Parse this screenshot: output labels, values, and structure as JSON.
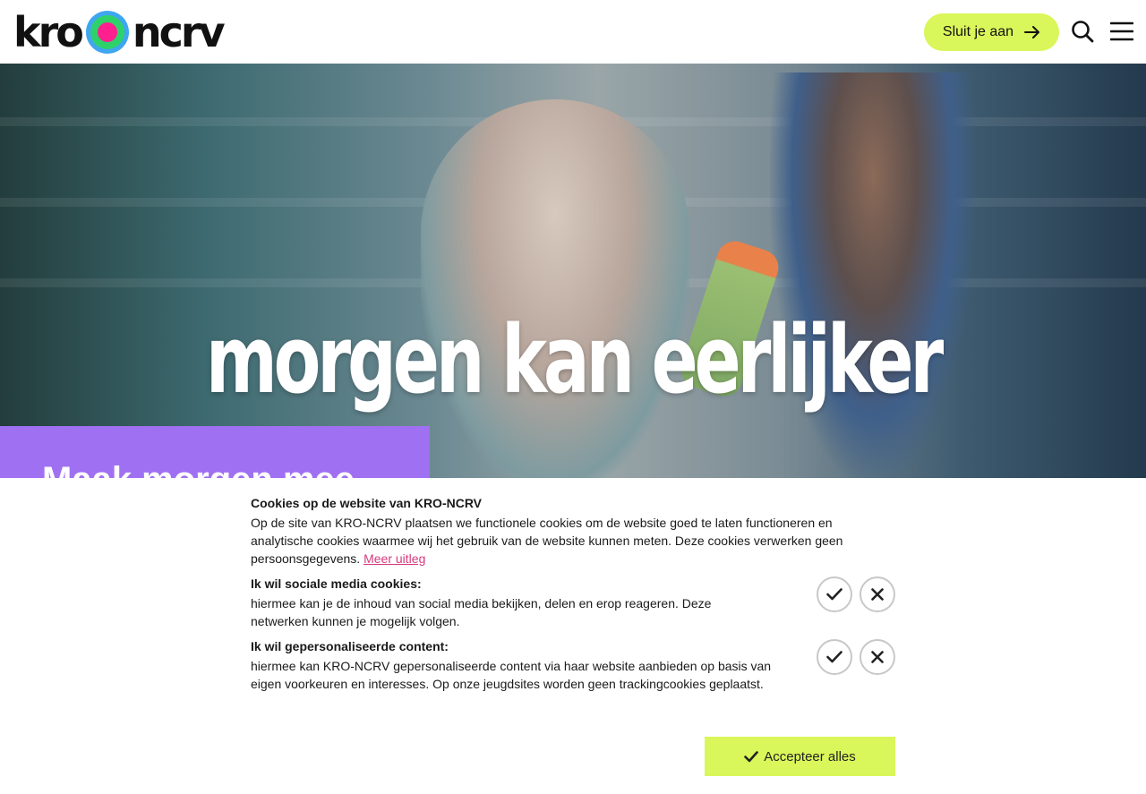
{
  "header": {
    "logo": {
      "left_text": "kro",
      "right_text": "ncrv",
      "icon": "kro-ncrv-circle-logo"
    },
    "join_label": "Sluit je aan",
    "join_icon": "arrow-right-icon",
    "search_icon": "search-icon",
    "menu_icon": "hamburger-menu-icon"
  },
  "hero": {
    "overlay_text": "morgen kan eerlijker",
    "headline": "Maak morgen mee"
  },
  "cookie": {
    "title": "Cookies op de website van KRO-NCRV",
    "intro": "Op de site van KRO-NCRV plaatsen we functionele cookies om de website goed te laten functioneren en analytische cookies waarmee wij het gebruik van de website kunnen meten. Deze cookies verwerken geen persoonsgegevens.",
    "more_link": "Meer uitleg",
    "sections": [
      {
        "title": "Ik wil sociale media cookies:",
        "text": "hiermee kan je de inhoud van social media bekijken, delen en erop reageren. Deze netwerken kunnen je mogelijk volgen."
      },
      {
        "title": "Ik wil gepersonaliseerde content:",
        "text": "hiermee kan KRO-NCRV gepersonaliseerde content via haar website aanbieden op basis van eigen voorkeuren en interesses. Op onze jeugdsites worden geen trackingcookies geplaatst."
      }
    ],
    "accept_all": "Accepteer alles",
    "accept_icon": "checkmark-icon",
    "decline_icon": "close-icon"
  },
  "colors": {
    "accent_lime": "#d9f75a",
    "purple": "#a070f2",
    "link_pink": "#d83a7e"
  }
}
